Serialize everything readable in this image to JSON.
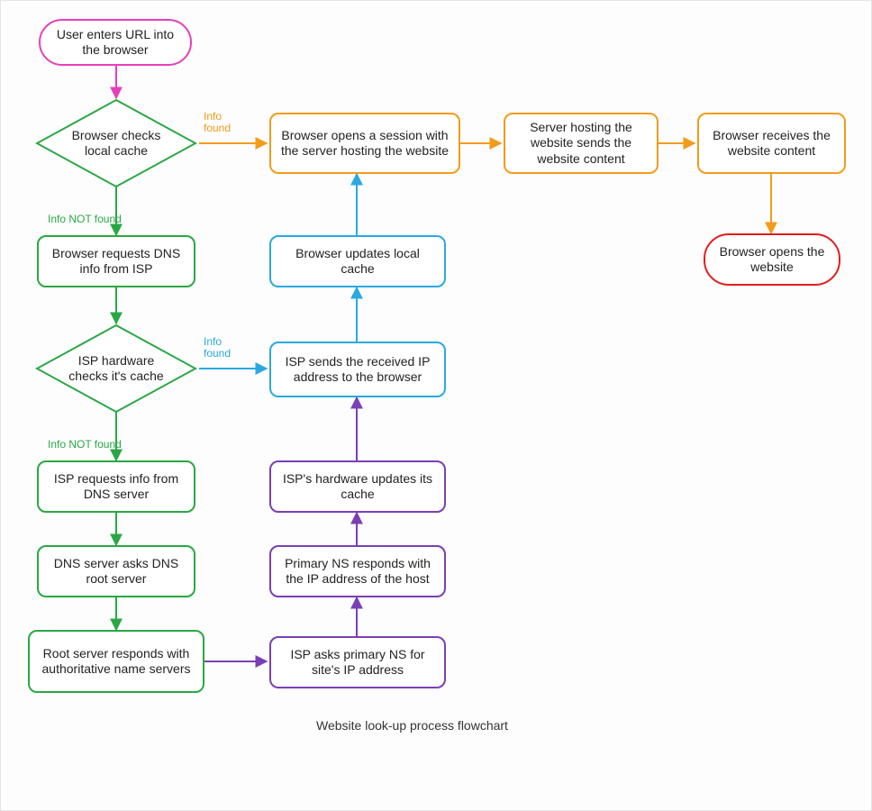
{
  "caption": "Website look-up process flowchart",
  "colors": {
    "pink": "#e83fbb",
    "green": "#2aa745",
    "orange": "#f39b1b",
    "blue": "#2aa9e0",
    "purple": "#7b3fb5",
    "red": "#e11d1d"
  },
  "labels": {
    "info_found_1": "Info\nfound",
    "info_not_found_1": "Info NOT found",
    "info_found_2": "Info\nfound",
    "info_not_found_2": "Info NOT found"
  },
  "nodes": {
    "start": {
      "text": "User enters URL into the browser"
    },
    "check_local": {
      "text": "Browser checks local cache"
    },
    "req_dns_isp": {
      "text": "Browser requests DNS info from ISP"
    },
    "isp_check_cache": {
      "text": "ISP hardware checks it's cache"
    },
    "isp_req_dns_server": {
      "text": "ISP requests info from DNS server"
    },
    "dns_asks_root": {
      "text": "DNS server asks DNS root server"
    },
    "root_responds": {
      "text": "Root server responds with authoritative name servers"
    },
    "isp_asks_primary": {
      "text": "ISP asks primary NS for site's IP address"
    },
    "primary_responds": {
      "text": "Primary NS responds with the IP address of the host"
    },
    "isp_hw_updates": {
      "text": "ISP's hardware updates its cache"
    },
    "isp_sends_ip": {
      "text": "ISP sends the received IP address to the browser"
    },
    "browser_updates": {
      "text": "Browser updates local cache"
    },
    "open_session": {
      "text": "Browser opens a session with the server hosting the website"
    },
    "server_sends": {
      "text": "Server hosting the website sends the website content"
    },
    "browser_receives": {
      "text": "Browser receives the website content"
    },
    "browser_opens": {
      "text": "Browser opens the website"
    }
  }
}
